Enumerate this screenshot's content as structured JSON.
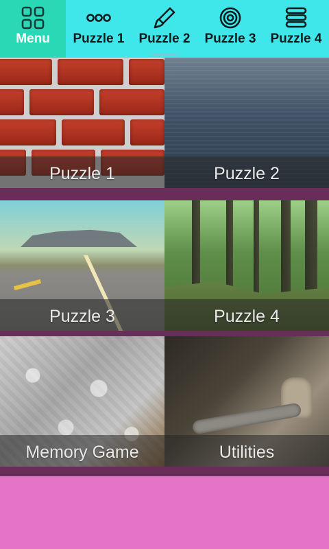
{
  "colors": {
    "tabbar_bg": "#3fe6ea",
    "tab_active_bg": "#2bd8b6",
    "grid_bg": "#6a2c59",
    "footer_bg": "#e374c6"
  },
  "tabbar": {
    "tabs": [
      {
        "label": "Menu",
        "icon": "grid-icon"
      },
      {
        "label": "Puzzle 1",
        "icon": "dots-icon"
      },
      {
        "label": "Puzzle 2",
        "icon": "brush-icon"
      },
      {
        "label": "Puzzle 3",
        "icon": "target-icon"
      },
      {
        "label": "Puzzle 4",
        "icon": "stack-icon"
      }
    ]
  },
  "tiles": [
    {
      "label": "Puzzle 1",
      "image": "brick-wall-image"
    },
    {
      "label": "Puzzle 2",
      "image": "sea-image"
    },
    {
      "label": "Puzzle 3",
      "image": "desert-road-image"
    },
    {
      "label": "Puzzle 4",
      "image": "forest-image"
    },
    {
      "label": "Memory Game",
      "image": "jigsaw-pieces-image"
    },
    {
      "label": "Utilities",
      "image": "tools-image"
    }
  ]
}
